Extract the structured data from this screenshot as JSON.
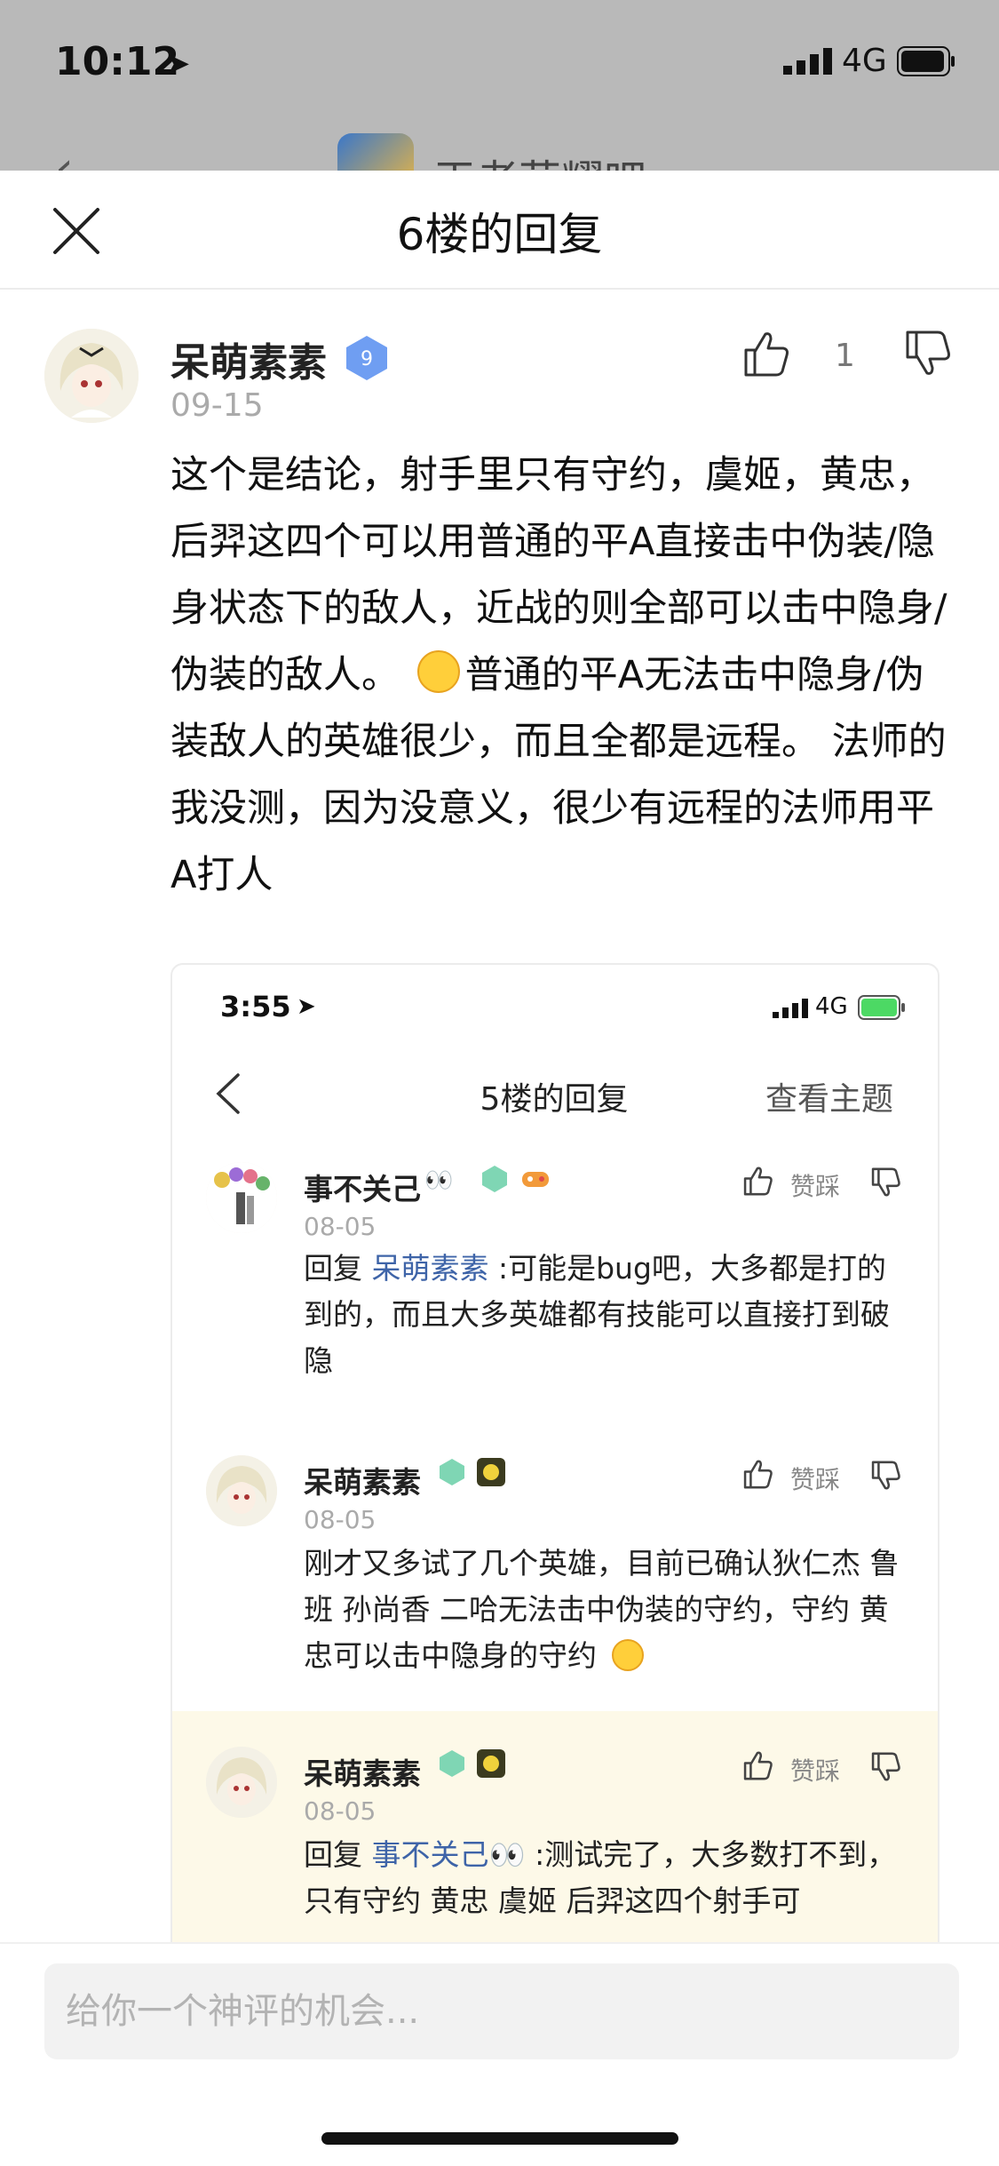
{
  "status_bar": {
    "time": "10:12",
    "network": "4G"
  },
  "behind": {
    "title": "王者荣耀吧"
  },
  "sheet": {
    "title": "6楼的回复"
  },
  "main_reply": {
    "author": "呆萌素素",
    "level": "9",
    "date": "09-15",
    "like_count": "1",
    "text_part1": "这个是结论，射手里只有守约，虞姬，黄忠，后羿这四个可以用普通的平A直接击中伪装/隐身状态下的敌人，近战的则全部可以击中隐身/伪装的敌人。",
    "text_part2": "普通的平A无法击中隐身/伪装敌人的英雄很少，而且全都是远程。 法师的我没测，因为没意义，很少有远程的法师用平A打人"
  },
  "embedded": {
    "time": "3:55",
    "network": "4G",
    "title": "5楼的回复",
    "view_topic": "查看主题",
    "step_label": "赞踩",
    "comments": [
      {
        "author": "事不关己",
        "emoji": "👀",
        "date": "08-05",
        "reply_prefix": "回复 ",
        "mention": "呆萌素素",
        "text": " :可能是bug吧，大多都是打的到的，而且大多英雄都有技能可以直接打到破隐"
      },
      {
        "author": "呆萌素素",
        "date": "08-05",
        "text": "刚才又多试了几个英雄，目前已确认狄仁杰 鲁班 孙尚香 二哈无法击中伪装的守约，守约 黄忠可以击中隐身的守约"
      },
      {
        "author": "呆萌素素",
        "date": "08-05",
        "reply_prefix": "回复 ",
        "mention": "事不关己",
        "mention_emoji": "👀",
        "text": " :测试完了，大多数打不到，只有守约 黄忠 虞姬 后羿这四个射手可"
      }
    ]
  },
  "input": {
    "placeholder": "给你一个神评的机会..."
  },
  "colors": {
    "link": "#3e64a8",
    "highlight_bg": "#fdf9e8",
    "badge_blue": "#5b8def"
  }
}
